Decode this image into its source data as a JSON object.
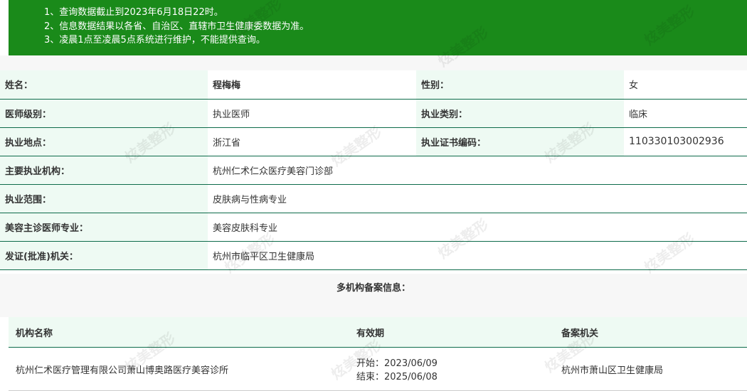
{
  "notice": [
    "1、查询数据截止到2023年6月18日22时。",
    "2、信息数据结果以各省、自治区、直辖市卫生健康委数据为准。",
    "3、凌晨1点至凌晨5点系统进行维护，不能提供查询。"
  ],
  "info": {
    "name_label": "姓名：",
    "name_value": "程梅梅",
    "gender_label": "性别：",
    "gender_value": "女",
    "level_label": "医师级别：",
    "level_value": "执业医师",
    "category_label": "执业类别：",
    "category_value": "临床",
    "location_label": "执业地点：",
    "location_value": "浙江省",
    "cert_label": "执业证书编码：",
    "cert_value": "110330103002936",
    "institution_label": "主要执业机构：",
    "institution_value": "杭州仁术仁众医疗美容门诊部",
    "scope_label": "执业范围：",
    "scope_value": "皮肤病与性病专业",
    "cosmetic_label": "美容主诊医师专业：",
    "cosmetic_value": "美容皮肤科专业",
    "issuer_label": "发证(批准)机关：",
    "issuer_value": "杭州市临平区卫生健康局"
  },
  "multi": {
    "title": "多机构备案信息：",
    "headers": [
      "机构名称",
      "有效期",
      "备案机关"
    ],
    "rows": [
      {
        "org": "杭州仁术医疗管理有限公司萧山博奥路医疗美容诊所",
        "start": "开始：2023/06/09",
        "end": "结束：2025/06/08",
        "authority": "杭州市萧山区卫生健康局"
      }
    ]
  },
  "watermark": "炫美整形"
}
